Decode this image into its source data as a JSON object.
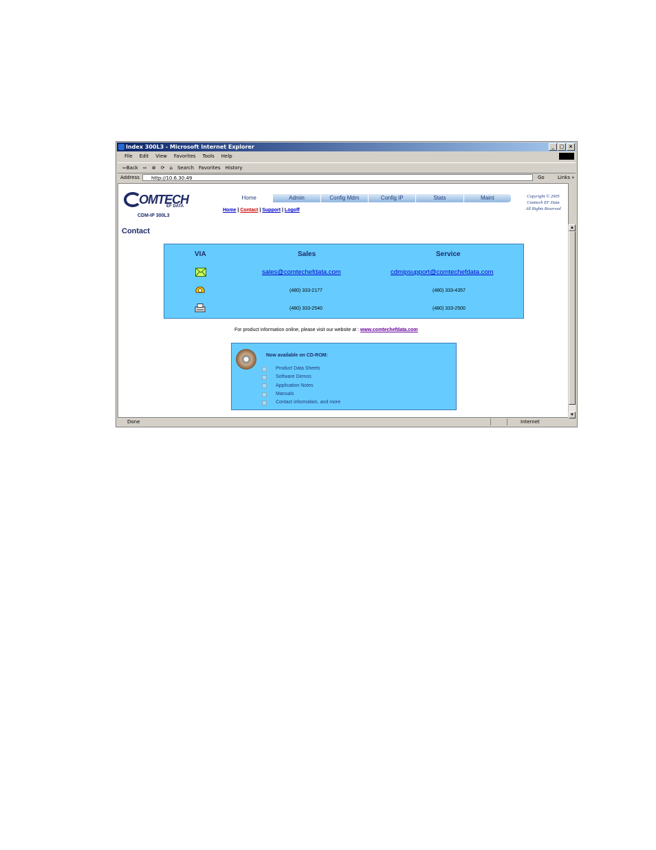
{
  "window": {
    "title": "Index 300L3 - Microsoft Internet Explorer",
    "controls": [
      "_",
      "□",
      "×"
    ]
  },
  "menu": [
    "File",
    "Edit",
    "View",
    "Favorites",
    "Tools",
    "Help"
  ],
  "toolbar": {
    "back": "⇦Back",
    "forward": "⇨",
    "stop_icon": "stop-icon",
    "refresh_icon": "refresh-icon",
    "home_icon": "home-icon",
    "search": "Search",
    "favorites": "Favorites",
    "history": "History"
  },
  "address": {
    "label": "Address",
    "url": "http://10.6.30.49",
    "go": "Go",
    "links": "Links »"
  },
  "header": {
    "logo": "OMTECH",
    "logo_sub": "EF DATA",
    "model": "CDM-IP 300L3",
    "nav_tabs": [
      "Home",
      "Admin",
      "Config Mdm",
      "Config IP",
      "Stats",
      "Maint"
    ],
    "sublinks": [
      "Home",
      "Contact",
      "Support",
      "Logoff"
    ],
    "copyright": [
      "Copyright © 2005",
      "Comtech EF Data",
      "All Rights Reserved"
    ]
  },
  "page_title": "Contact",
  "contact_table": {
    "headers": [
      "VIA",
      "Sales",
      "Service"
    ],
    "email": {
      "icon": "envelope-icon",
      "sales": "sales@comtechefdata.com",
      "service": "cdmipsupport@comtechefdata.com"
    },
    "phone": {
      "icon": "telephone-icon",
      "sales": "(480) 333-2177",
      "service": "(480) 333-4357"
    },
    "fax": {
      "icon": "fax-icon",
      "sales": "(480) 333-2540",
      "service": "(480) 333-2500"
    }
  },
  "online": {
    "text": "For product information online, please visit our website at :",
    "link": "www.comtechefdata.com"
  },
  "cdrom": {
    "title": "Now available on CD-ROM:",
    "items": [
      "Product Data Sheets",
      "Software Demos",
      "Application Notes",
      "Manuals",
      "Contact information, and more"
    ]
  },
  "status": {
    "left": "Done",
    "zone": "Internet"
  }
}
